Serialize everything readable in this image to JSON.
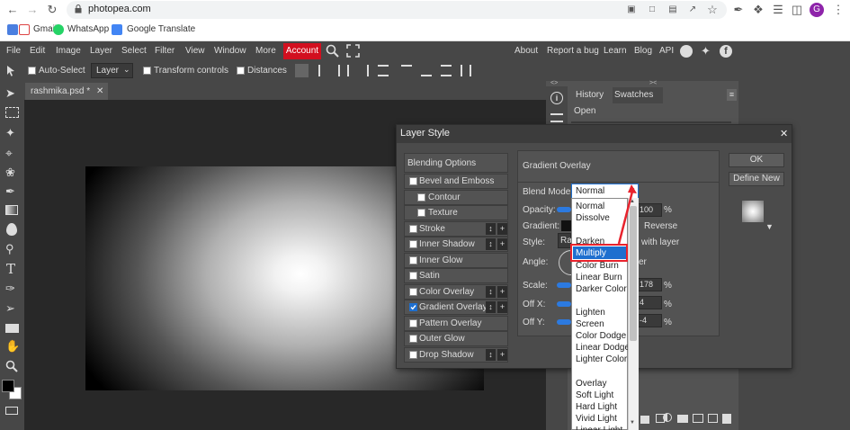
{
  "browser": {
    "url": "photopea.com",
    "bookmarks": [
      "Gmail",
      "WhatsApp",
      "Google Translate"
    ],
    "profile_initial": "G"
  },
  "menu": {
    "items": [
      "File",
      "Edit",
      "Image",
      "Layer",
      "Select",
      "Filter",
      "View",
      "Window",
      "More",
      "Account"
    ],
    "right_items": [
      "About",
      "Report a bug",
      "Learn",
      "Blog",
      "API"
    ]
  },
  "options_bar": {
    "auto_select": "Auto-Select",
    "layer_select": "Layer",
    "transform_controls": "Transform controls",
    "distances": "Distances"
  },
  "document_tab": {
    "name": "rashmika.psd *",
    "close": "✕"
  },
  "right_panel": {
    "tabs": [
      "History",
      "Swatches"
    ],
    "history_items": [
      "Open"
    ]
  },
  "dialog": {
    "title": "Layer Style",
    "close": "✕",
    "blending_options": "Blending Options",
    "styles": [
      {
        "label": "Bevel and Emboss",
        "checked": false,
        "plus": false
      },
      {
        "label": "Contour",
        "checked": false,
        "plus": false,
        "indent": true
      },
      {
        "label": "Texture",
        "checked": false,
        "plus": false,
        "indent": true
      },
      {
        "label": "Stroke",
        "checked": false,
        "plus": true
      },
      {
        "label": "Inner Shadow",
        "checked": false,
        "plus": true
      },
      {
        "label": "Inner Glow",
        "checked": false,
        "plus": false
      },
      {
        "label": "Satin",
        "checked": false,
        "plus": false
      },
      {
        "label": "Color Overlay",
        "checked": false,
        "plus": true
      },
      {
        "label": "Gradient Overlay",
        "checked": true,
        "plus": true
      },
      {
        "label": "Pattern Overlay",
        "checked": false,
        "plus": false
      },
      {
        "label": "Outer Glow",
        "checked": false,
        "plus": false
      },
      {
        "label": "Drop Shadow",
        "checked": false,
        "plus": true
      }
    ],
    "section_title": "Gradient Overlay",
    "blend_mode_label": "Blend Mode:",
    "blend_mode_value": "Normal",
    "opacity_label": "Opacity:",
    "opacity_value": "100",
    "opacity_unit": "%",
    "gradient_label": "Gradient:",
    "reverse_label": "Reverse",
    "style_label": "Style:",
    "style_value": "Ra",
    "align_label": "with layer",
    "angle_label": "Angle:",
    "angle_suffix": "er",
    "scale_label": "Scale:",
    "scale_value": "178",
    "scale_unit": "%",
    "offx_label": "Off X:",
    "offx_value": "4",
    "offx_unit": "%",
    "offy_label": "Off Y:",
    "offy_value": "-4",
    "offy_unit": "%",
    "ok": "OK",
    "define_new": "Define New"
  },
  "blend_dropdown": {
    "selected": "Multiply",
    "options": [
      "Normal",
      "Dissolve",
      "",
      "Darken",
      "Multiply",
      "Color Burn",
      "Linear Burn",
      "Darker Color",
      "",
      "Lighten",
      "Screen",
      "Color Dodge",
      "Linear Dodge",
      "Lighter Color",
      "",
      "Overlay",
      "Soft Light",
      "Hard Light",
      "Vivid Light",
      "Linear Light"
    ]
  },
  "colors": {
    "accent": "#2c7ae0",
    "selection": "#1e6fcf",
    "annotation_red": "#e8232d",
    "account_red": "#d20f1f",
    "panel_bg": "#474747"
  }
}
